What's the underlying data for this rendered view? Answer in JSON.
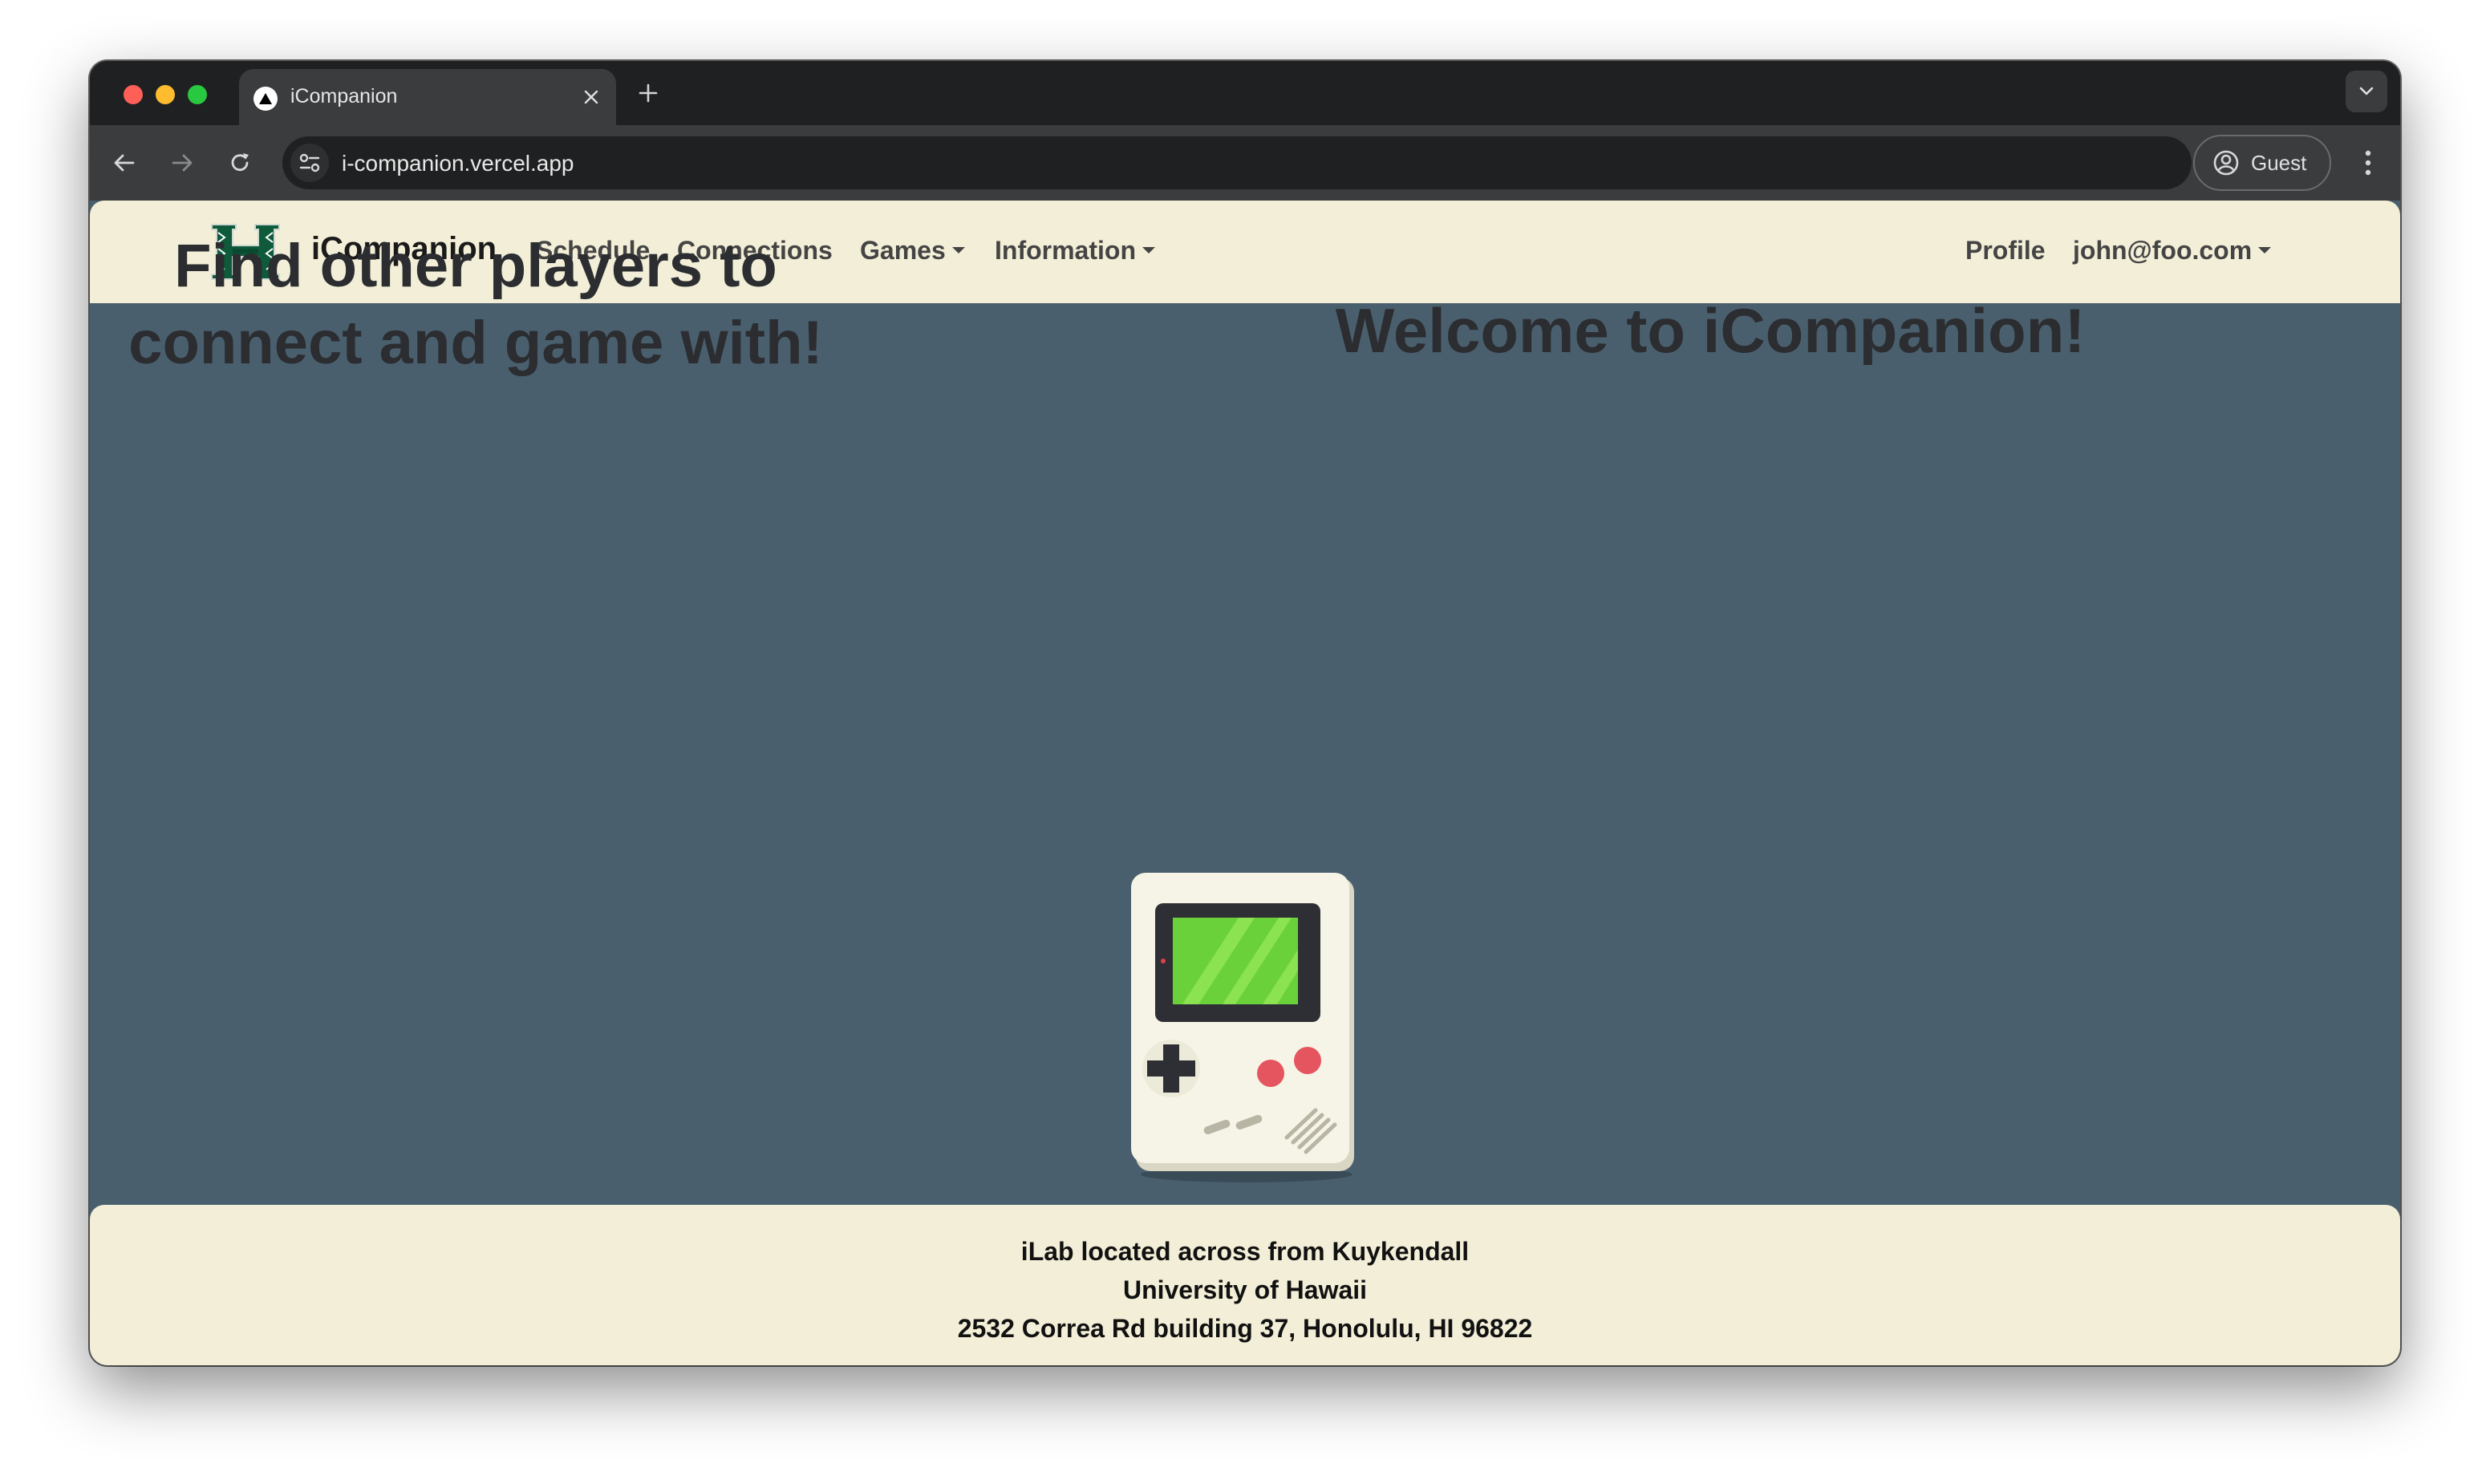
{
  "browser": {
    "tab_title": "iCompanion",
    "url": "i-companion.vercel.app",
    "profile_label": "Guest"
  },
  "navbar": {
    "brand": "iCompanion",
    "links": {
      "schedule": "Schedule",
      "connections": "Connections",
      "games": "Games",
      "information": "Information",
      "profile": "Profile",
      "user": "john@foo.com"
    }
  },
  "hero": {
    "left_heading": "Find other players to connect and game with!",
    "right_heading": "Welcome to iCompanion!"
  },
  "footer": {
    "line1": "iLab located across from Kuykendall",
    "line2": "University of Hawaii",
    "line3": "2532 Correa Rd building 37, Honolulu, HI 96822"
  },
  "colors": {
    "page_background": "#4a5f6e",
    "navbar_background": "#f2eed7",
    "brand_green": "#0e5a3a"
  },
  "icons": [
    "vercel-triangle-icon",
    "close-icon",
    "plus-icon",
    "chevron-down-icon",
    "back-arrow-icon",
    "forward-arrow-icon",
    "reload-icon",
    "site-settings-icon",
    "guest-profile-icon",
    "kebab-menu-icon",
    "hawaii-h-logo",
    "gameboy-illustration"
  ]
}
